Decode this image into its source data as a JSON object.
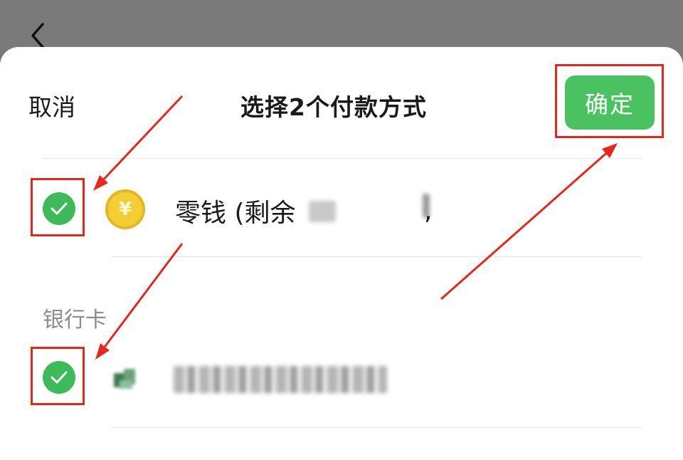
{
  "header": {
    "cancel_label": "取消",
    "title": "选择2个付款方式",
    "confirm_label": "确定"
  },
  "icons": {
    "back": "chevron-left-icon",
    "check": "check-circle-icon",
    "coin": "yuan-coin-icon",
    "bank": "bank-logo-icon"
  },
  "payment_methods": {
    "change": {
      "label_prefix": "零钱 (剩余",
      "label_suffix": ",",
      "coin_symbol": "¥",
      "selected": true
    },
    "bank_section_label": "银行卡",
    "bank_card": {
      "selected": true
    }
  },
  "colors": {
    "overlay_bg": "#7a7a7a",
    "accent_green": "#4ac262",
    "annotation_red": "#e5271d"
  }
}
